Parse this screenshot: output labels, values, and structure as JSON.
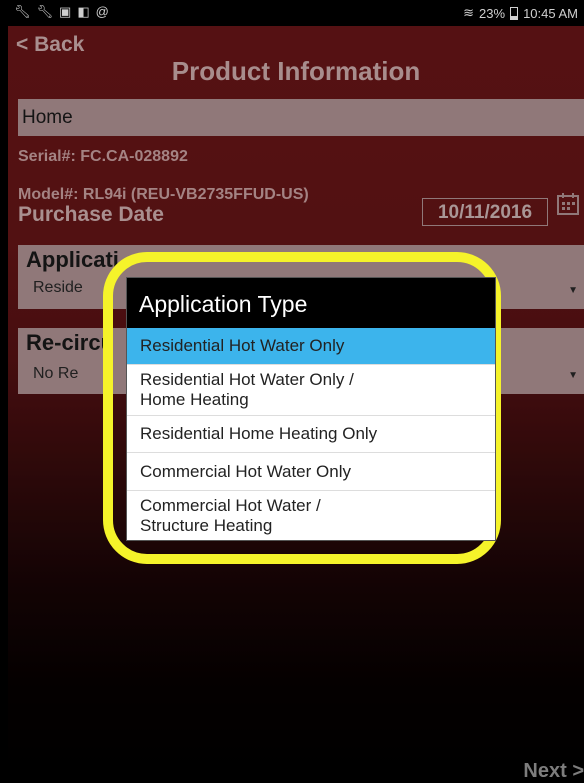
{
  "status_bar": {
    "left_icons": [
      "wrench-icon",
      "wrench-icon",
      "image-icon",
      "clipboard-icon",
      "at-icon"
    ],
    "battery": "23%",
    "time": "10:45 AM"
  },
  "header": {
    "back_label": "< Back",
    "title": "Product Information"
  },
  "form": {
    "location_value": "Home",
    "serial": "Serial#: FC.CA-028892",
    "model": "Model#: RL94i (REU-VB2735FFUD-US)",
    "purchase_date_label": "Purchase Date",
    "purchase_date_value": "10/11/2016",
    "application_panel_title": "Applicati",
    "application_value": "Reside",
    "recirc_panel_title": "Re-circu",
    "recirc_value": "No Re"
  },
  "dialog": {
    "title": "Application Type",
    "options": [
      {
        "line1": "Residential Hot Water Only",
        "line2": "",
        "selected": true
      },
      {
        "line1": "Residential Hot Water Only /",
        "line2": "Home Heating",
        "selected": false
      },
      {
        "line1": "Residential Home Heating Only",
        "line2": "",
        "selected": false
      },
      {
        "line1": "Commercial Hot Water Only",
        "line2": "",
        "selected": false
      },
      {
        "line1": "Commercial Hot Water /",
        "line2": "Structure Heating",
        "selected": false
      }
    ]
  },
  "footer": {
    "next_label": "Next >"
  },
  "colors": {
    "background_top": "#6e1719",
    "field_background": "#b99a9b",
    "highlight_ring": "#f5f32a",
    "selected_option": "#3cb4ec"
  }
}
